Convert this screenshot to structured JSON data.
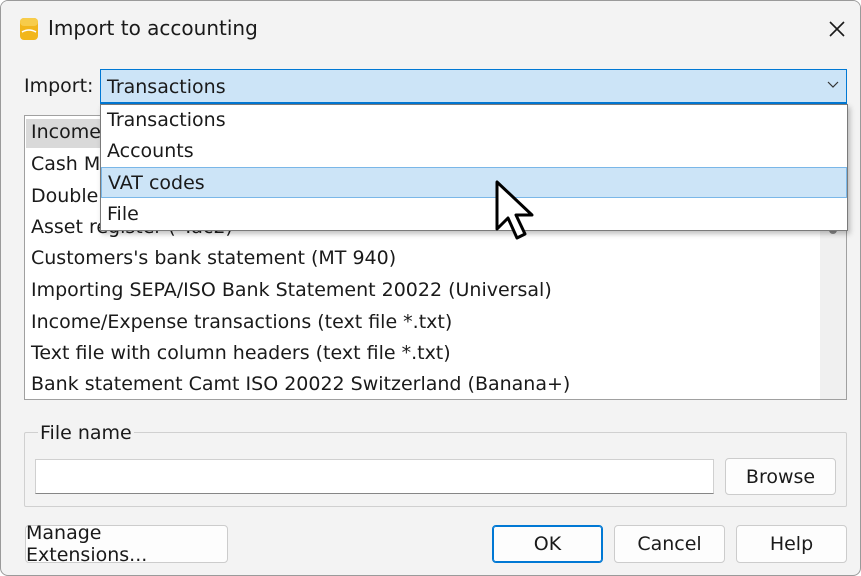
{
  "window": {
    "title": "Import to accounting"
  },
  "import": {
    "label": "Import:",
    "selected": "Transactions",
    "options": [
      "Transactions",
      "Accounts",
      "VAT codes",
      "File"
    ],
    "hovered": "VAT codes"
  },
  "list": {
    "items": [
      "Income",
      "Cash M",
      "Double",
      "Asset register (*.ac2)",
      "Customers's bank statement (MT 940)",
      "Importing SEPA/ISO Bank Statement 20022 (Universal)",
      "Income/Expense transactions (text file *.txt)",
      "Text file with column headers (text file *.txt)",
      "Bank statement Camt ISO 20022 Switzerland (Banana+)"
    ]
  },
  "file": {
    "group_label": "File name",
    "value": "",
    "browse_label": "Browse"
  },
  "buttons": {
    "manage": "Manage Extensions...",
    "ok": "OK",
    "cancel": "Cancel",
    "help": "Help"
  },
  "colors": {
    "accent": "#0078d4",
    "selection": "#cce4f7",
    "app_icon": "#f2b61b"
  },
  "icons": {
    "app": "banana-app-icon",
    "close": "close-icon",
    "dropdown": "chevron-down-icon",
    "cursor": "mouse-pointer-icon"
  }
}
